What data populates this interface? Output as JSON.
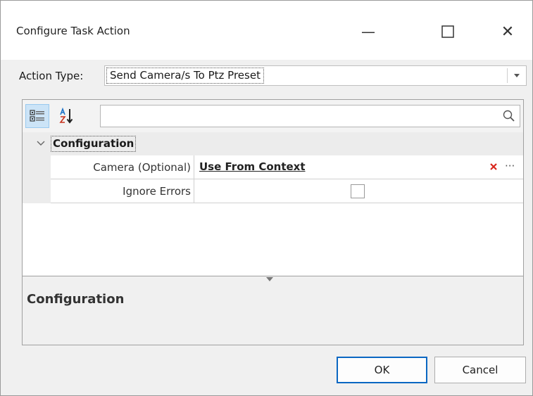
{
  "window": {
    "title": "Configure Task Action",
    "minimize_glyph": "—",
    "close_glyph": "✕"
  },
  "action_type": {
    "label": "Action Type:",
    "value": "Send Camera/s To Ptz Preset"
  },
  "toolbar": {
    "categorized_icon": "categorized-icon",
    "alphabetical_icon": "sort-alphabetical-icon",
    "search_value": "",
    "search_icon": "search-icon"
  },
  "grid": {
    "category": "Configuration",
    "properties": [
      {
        "name": "Camera (Optional)",
        "value": "Use From Context",
        "ellipsis": "···"
      },
      {
        "name": "Ignore Errors",
        "checked": false
      }
    ]
  },
  "description": {
    "title": "Configuration"
  },
  "buttons": {
    "ok": "OK",
    "cancel": "Cancel"
  },
  "colors": {
    "accent": "#0a67c2",
    "clear_red": "#d9261c",
    "selected_tool": "#cce4f7"
  }
}
